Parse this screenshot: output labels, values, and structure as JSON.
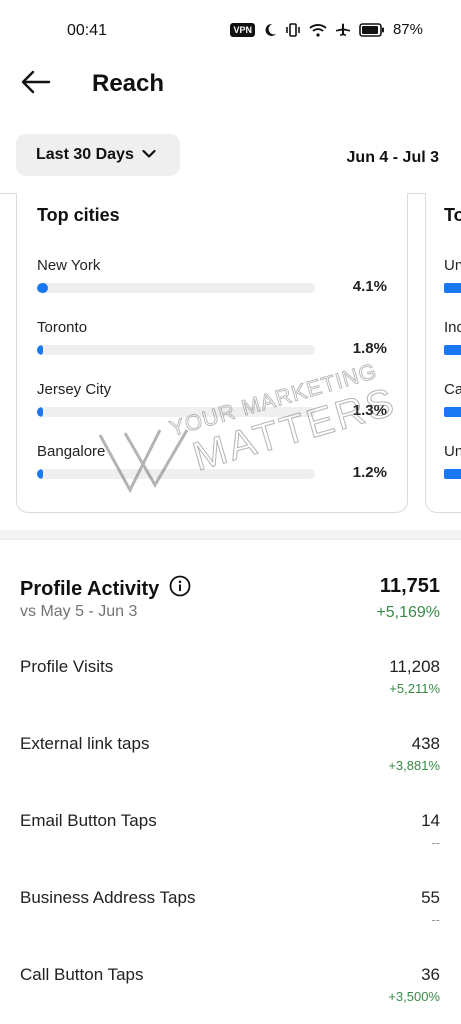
{
  "status_bar": {
    "time": "00:41",
    "vpn": "VPN",
    "battery": "87%",
    "icons": [
      "moon-icon",
      "vibrate-icon",
      "wifi-icon",
      "airplane-icon",
      "battery-icon"
    ]
  },
  "header": {
    "title": "Reach",
    "back_icon": "arrow-left-icon"
  },
  "filters": {
    "range_label": "Last 30 Days",
    "date_range": "Jun 4 - Jul 3"
  },
  "top_cities": {
    "title": "Top cities",
    "items": [
      {
        "name": "New York",
        "percent": "4.1%",
        "value": 4.1
      },
      {
        "name": "Toronto",
        "percent": "1.8%",
        "value": 1.8
      },
      {
        "name": "Jersey City",
        "percent": "1.3%",
        "value": 1.3
      },
      {
        "name": "Bangalore",
        "percent": "1.2%",
        "value": 1.2
      }
    ]
  },
  "next_card": {
    "title": "To",
    "items": [
      "Un",
      "Ind",
      "Ca",
      "Un"
    ]
  },
  "watermark": {
    "line1": "YOUR MARKETING",
    "line2": "MATTERS"
  },
  "profile_activity": {
    "title": "Profile Activity",
    "comparison": "vs May 5 - Jun 3",
    "total": "11,751",
    "total_change": "+5,169%",
    "metrics": [
      {
        "label": "Profile Visits",
        "value": "11,208",
        "change": "+5,211%"
      },
      {
        "label": "External link taps",
        "value": "438",
        "change": "+3,881%"
      },
      {
        "label": "Email Button Taps",
        "value": "14",
        "change": "--"
      },
      {
        "label": "Business Address Taps",
        "value": "55",
        "change": "--"
      },
      {
        "label": "Call Button Taps",
        "value": "36",
        "change": "+3,500%"
      }
    ]
  },
  "colors": {
    "accent": "#1877f2",
    "positive": "#3a8a47",
    "muted": "#737373"
  }
}
